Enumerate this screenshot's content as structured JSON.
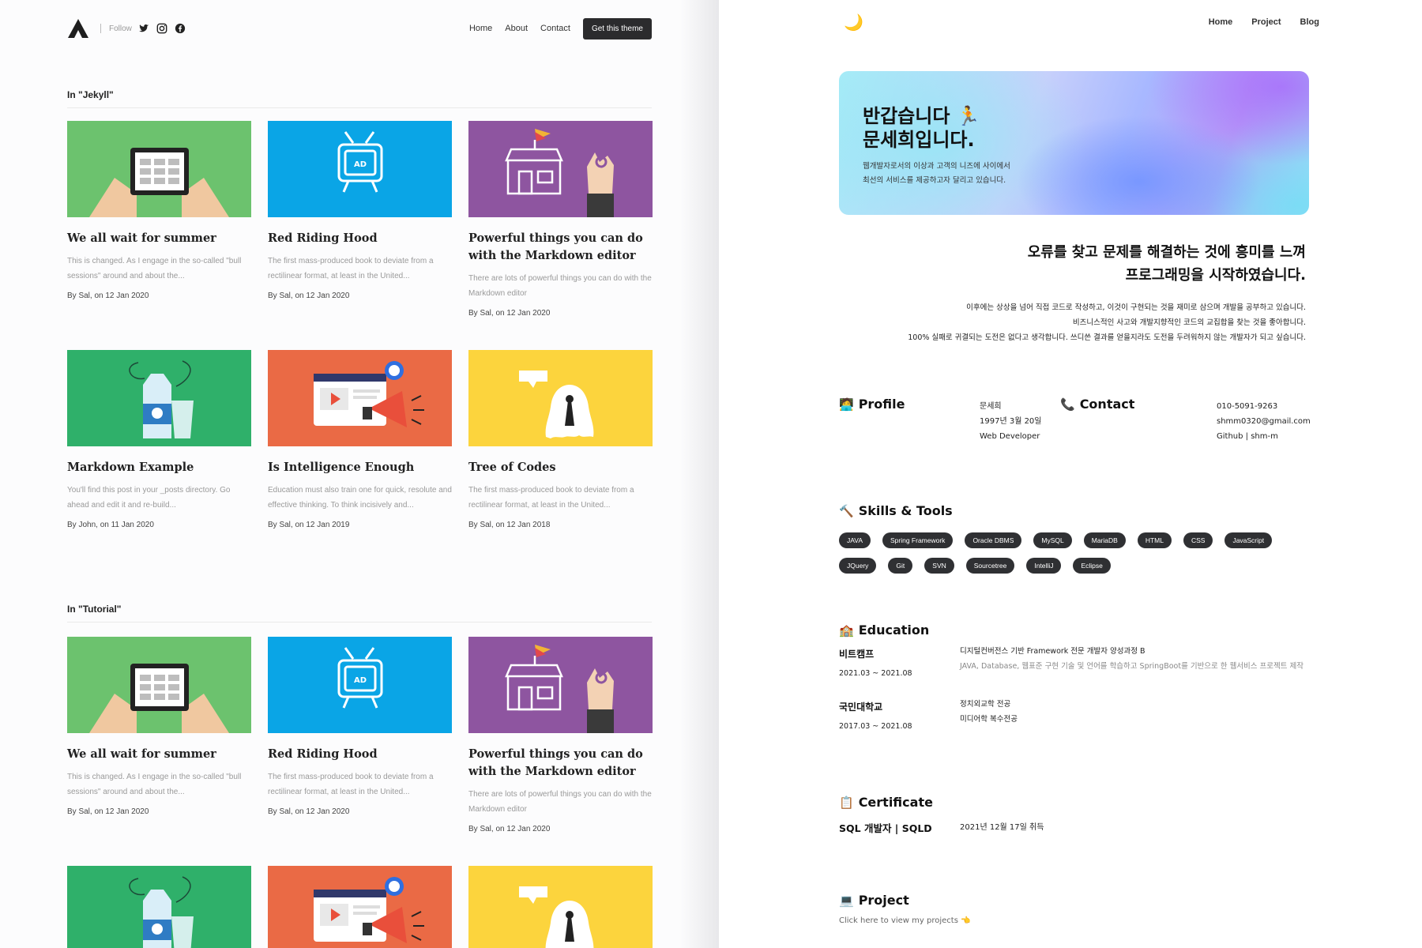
{
  "left": {
    "header": {
      "follow_label": "Follow",
      "nav": [
        "Home",
        "About",
        "Contact"
      ],
      "cta": "Get this theme",
      "social_icons": [
        "twitter-icon",
        "instagram-icon",
        "facebook-icon"
      ]
    },
    "sections": [
      {
        "title": "In \"Jekyll\"",
        "cards": [
          {
            "title": "We all wait for summer",
            "excerpt": "This is changed. As I engage in the so-called \"bull sessions\" around and about the...",
            "meta": "By Sal, on 12 Jan 2020",
            "image": "tablet",
            "color": "#6cc26e"
          },
          {
            "title": "Red Riding Hood",
            "excerpt": "The first mass-produced book to deviate from a rectilinear format, at least in the United...",
            "meta": "By Sal, on 12 Jan 2020",
            "image": "tv",
            "color": "#0aa5e6"
          },
          {
            "title": "Powerful things you can do with the Markdown editor",
            "excerpt": "There are lots of powerful things you can do with the Markdown editor",
            "meta": "By Sal, on 12 Jan 2020",
            "image": "shop",
            "color": "#8e55a0"
          },
          {
            "title": "Markdown Example",
            "excerpt": "You'll find this post in your _posts directory. Go ahead and edit it and re-build...",
            "meta": "By John, on 11 Jan 2020",
            "image": "milk",
            "color": "#2fb06a"
          },
          {
            "title": "Is Intelligence Enough",
            "excerpt": "Education must also train one for quick, resolute and effective thinking. To think incisively and...",
            "meta": "By Sal, on 12 Jan 2019",
            "image": "megaphone",
            "color": "#ea6a45"
          },
          {
            "title": "Tree of Codes",
            "excerpt": "The first mass-produced book to deviate from a rectilinear format, at least in the United...",
            "meta": "By Sal, on 12 Jan 2018",
            "image": "ghost",
            "color": "#fcd43d"
          }
        ]
      },
      {
        "title": "In \"Tutorial\"",
        "cards": [
          {
            "title": "We all wait for summer",
            "excerpt": "This is changed. As I engage in the so-called \"bull sessions\" around and about the...",
            "meta": "By Sal, on 12 Jan 2020",
            "image": "tablet",
            "color": "#6cc26e"
          },
          {
            "title": "Red Riding Hood",
            "excerpt": "The first mass-produced book to deviate from a rectilinear format, at least in the United...",
            "meta": "By Sal, on 12 Jan 2020",
            "image": "tv",
            "color": "#0aa5e6"
          },
          {
            "title": "Powerful things you can do with the Markdown editor",
            "excerpt": "There are lots of powerful things you can do with the Markdown editor",
            "meta": "By Sal, on 12 Jan 2020",
            "image": "shop",
            "color": "#8e55a0"
          },
          {
            "title": "",
            "excerpt": "",
            "meta": "",
            "image": "milk",
            "color": "#2fb06a"
          },
          {
            "title": "",
            "excerpt": "",
            "meta": "",
            "image": "megaphone",
            "color": "#ea6a45"
          },
          {
            "title": "",
            "excerpt": "",
            "meta": "",
            "image": "ghost",
            "color": "#fcd43d"
          }
        ]
      }
    ]
  },
  "right": {
    "nav": [
      "Home",
      "Project",
      "Blog"
    ],
    "logo_icon": "🌙",
    "hero": {
      "line1": "반갑습니다 🏃",
      "line2": "문세희입니다.",
      "sub1": "웹개발자로서의 이상과 고객의 니즈에 사이에서",
      "sub2": "최선의 서비스를 제공하고자 달리고 있습니다."
    },
    "quote": {
      "line1": "오류를 찾고 문제를 해결하는 것에 흥미를 느껴",
      "line2": "프로그래밍을 시작하였습니다."
    },
    "intro": [
      "이후에는 상상을 넘어 직접 코드로 작성하고, 이것이 구현되는 것을 재미로 삼으며 개발을 공부하고 있습니다.",
      "비즈니스적인 사고와 개발지향적인 코드의 교집합을 찾는 것을 좋아합니다.",
      "100% 실패로 귀결되는 도전은 없다고 생각합니다. 쓰디쓴 결과를 얻을지라도 도전을 두려워하지 않는 개발자가 되고 싶습니다."
    ],
    "profile": {
      "title": "Profile",
      "icon": "🧑‍💻",
      "lines": [
        "문세희",
        "1997년 3월 20일",
        "Web Developer"
      ]
    },
    "contact": {
      "title": "Contact",
      "icon": "📞",
      "lines": [
        "010-5091-9263",
        "shmm0320@gmail.com",
        "Github | shm-m"
      ]
    },
    "skills": {
      "title": "Skills & Tools",
      "icon": "🔨",
      "items": [
        "JAVA",
        "Spring Framework",
        "Oracle DBMS",
        "MySQL",
        "MariaDB",
        "HTML",
        "CSS",
        "JavaScript",
        "JQuery",
        "Git",
        "SVN",
        "Sourcetree",
        "IntelliJ",
        "Eclipse"
      ]
    },
    "education": {
      "title": "Education",
      "icon": "🏫",
      "items": [
        {
          "name": "비트캠프",
          "date": "2021.03 ~ 2021.08",
          "line1": "디지털컨버전스 기반 Framework 전문 개발자 양성과정 B",
          "line2": "JAVA, Database, 웹표준 구현 기술 및 언어를 학습하고 SpringBoot를 기반으로 한 웹서비스 프로젝트 제작"
        },
        {
          "name": "국민대학교",
          "date": "2017.03 ~ 2021.08",
          "line1": "정치외교학 전공",
          "line2": "미디어학 복수전공"
        }
      ]
    },
    "certificate": {
      "title": "Certificate",
      "icon": "📋",
      "name": "SQL 개발자 | SQLD",
      "date": "2021년 12월 17일 취득"
    },
    "project": {
      "title": "Project",
      "icon": "💻",
      "link": "Click here to view my projects 👈"
    }
  }
}
